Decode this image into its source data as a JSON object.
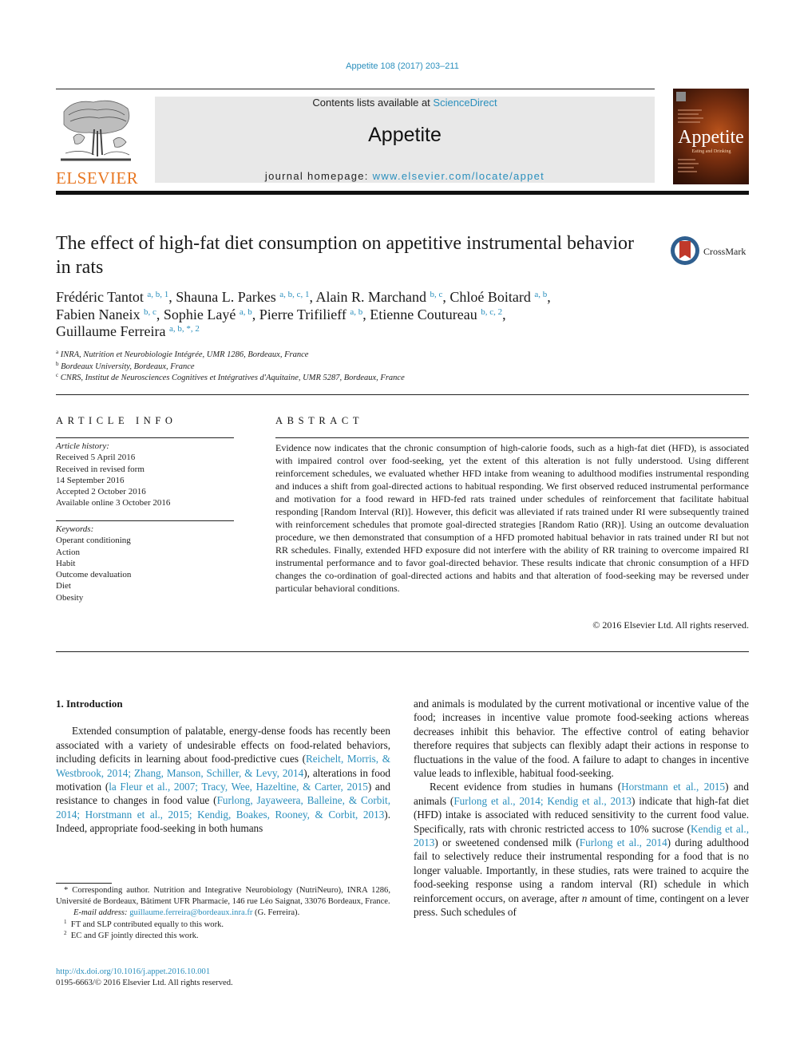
{
  "running_head": "Appetite 108 (2017) 203–211",
  "masthead": {
    "contents_prefix": "Contents lists available at ",
    "contents_link": "ScienceDirect",
    "journal_title": "Appetite",
    "homepage_prefix": "journal homepage: ",
    "homepage_link": "www.elsevier.com/locate/appet"
  },
  "publisher_logo": {
    "wordmark": "ELSEVIER",
    "icon": "elsevier-tree-icon",
    "color": "#e87722"
  },
  "cover": {
    "title": "Appetite",
    "subtitle": "Eating and Drinking"
  },
  "crossmark": {
    "label": "CrossMark",
    "icon": "crossmark-icon"
  },
  "article": {
    "title": "The effect of high-fat diet consumption on appetitive instrumental behavior in rats",
    "authors": [
      {
        "name": "Frédéric Tantot",
        "sup": "a, b, 1",
        "sep": ", "
      },
      {
        "name": "Shauna L. Parkes",
        "sup": "a, b, c, 1",
        "sep": ", "
      },
      {
        "name": "Alain R. Marchand",
        "sup": "b, c",
        "sep": ", "
      },
      {
        "name": "Chloé Boitard",
        "sup": "a, b",
        "sep": ","
      },
      {
        "name": "Fabien Naneix",
        "sup": "b, c",
        "sep": ", "
      },
      {
        "name": "Sophie Layé",
        "sup": "a, b",
        "sep": ", "
      },
      {
        "name": "Pierre Trifilieff",
        "sup": "a, b",
        "sep": ", "
      },
      {
        "name": "Etienne Coutureau",
        "sup": "b, c, 2",
        "sep": ","
      },
      {
        "name": "Guillaume Ferreira",
        "sup": "a, b, *, 2",
        "sep": ""
      }
    ],
    "affiliations": [
      {
        "mark": "a",
        "text": "INRA, Nutrition et Neurobiologie Intégrée, UMR 1286, Bordeaux, France"
      },
      {
        "mark": "b",
        "text": "Bordeaux University, Bordeaux, France"
      },
      {
        "mark": "c",
        "text": "CNRS, Institut de Neurosciences Cognitives et Intégratives d'Aquitaine, UMR 5287, Bordeaux, France"
      }
    ]
  },
  "article_info": {
    "heading": "ARTICLE INFO",
    "history_label": "Article history:",
    "history": [
      "Received 5 April 2016",
      "Received in revised form",
      "14 September 2016",
      "Accepted 2 October 2016",
      "Available online 3 October 2016"
    ],
    "keywords_label": "Keywords:",
    "keywords": [
      "Operant conditioning",
      "Action",
      "Habit",
      "Outcome devaluation",
      "Diet",
      "Obesity"
    ]
  },
  "abstract": {
    "heading": "ABSTRACT",
    "text": "Evidence now indicates that the chronic consumption of high-calorie foods, such as a high-fat diet (HFD), is associated with impaired control over food-seeking, yet the extent of this alteration is not fully understood. Using different reinforcement schedules, we evaluated whether HFD intake from weaning to adulthood modifies instrumental responding and induces a shift from goal-directed actions to habitual responding. We first observed reduced instrumental performance and motivation for a food reward in HFD-fed rats trained under schedules of reinforcement that facilitate habitual responding [Random Interval (RI)]. However, this deficit was alleviated if rats trained under RI were subsequently trained with reinforcement schedules that promote goal-directed strategies [Random Ratio (RR)]. Using an outcome devaluation procedure, we then demonstrated that consumption of a HFD promoted habitual behavior in rats trained under RI but not RR schedules. Finally, extended HFD exposure did not interfere with the ability of RR training to overcome impaired RI instrumental performance and to favor goal-directed behavior. These results indicate that chronic consumption of a HFD changes the co-ordination of goal-directed actions and habits and that alteration of food-seeking may be reversed under particular behavioral conditions.",
    "copyright": "© 2016 Elsevier Ltd. All rights reserved."
  },
  "body": {
    "section_heading": "1.  Introduction",
    "left_paragraph": [
      {
        "t": "Extended consumption of palatable, energy-dense foods has recently been associated with a variety of undesirable effects on food-related behaviors, including deficits in learning about food-predictive cues ("
      },
      {
        "l": "Reichelt, Morris, & Westbrook, 2014; Zhang, Manson, Schiller, & Levy, 2014"
      },
      {
        "t": "), alterations in food motivation ("
      },
      {
        "l": "la Fleur et al., 2007; Tracy, Wee, Hazeltine, & Carter, 2015"
      },
      {
        "t": ") and resistance to changes in food value ("
      },
      {
        "l": "Furlong, Jayaweera, Balleine, & Corbit, 2014; Horstmann et al., 2015; Kendig, Boakes, Rooney, & Corbit, 2013"
      },
      {
        "t": "). Indeed, appropriate food-seeking in both humans"
      }
    ],
    "right_paragraph_1": [
      {
        "t": "and animals is modulated by the current motivational or incentive value of the food; increases in incentive value promote food-seeking actions whereas decreases inhibit this behavior. The effective control of eating behavior therefore requires that subjects can flexibly adapt their actions in response to fluctuations in the value of the food. A failure to adapt to changes in incentive value leads to inflexible, habitual food-seeking."
      }
    ],
    "right_paragraph_2": [
      {
        "t": "Recent evidence from studies in humans ("
      },
      {
        "l": "Horstmann et al., 2015"
      },
      {
        "t": ") and animals ("
      },
      {
        "l": "Furlong et al., 2014; Kendig et al., 2013"
      },
      {
        "t": ") indicate that high-fat diet (HFD) intake is associated with reduced sensitivity to the current food value. Specifically, rats with chronic restricted access to 10% sucrose ("
      },
      {
        "l": "Kendig et al., 2013"
      },
      {
        "t": ") or sweetened condensed milk ("
      },
      {
        "l": "Furlong et al., 2014"
      },
      {
        "t": ") during adulthood fail to selectively reduce their instrumental responding for a food that is no longer valuable. Importantly, in these studies, rats were trained to acquire the food-seeking response using a random interval (RI) schedule in which reinforcement occurs, on average, after "
      },
      {
        "i": "n"
      },
      {
        "t": " amount of time, contingent on a lever press. Such schedules of"
      }
    ]
  },
  "footnotes": {
    "corresponding": "* Corresponding author. Nutrition and Integrative Neurobiology (NutriNeuro), INRA 1286, Université de Bordeaux, Bâtiment UFR Pharmacie, 146 rue Léo Saignat, 33076 Bordeaux, France.",
    "email_label": "E-mail address: ",
    "email": "guillaume.ferreira@bordeaux.inra.fr",
    "email_suffix": " (G. Ferreira).",
    "notes": [
      {
        "mark": "1",
        "text": "FT and SLP contributed equally to this work."
      },
      {
        "mark": "2",
        "text": "EC and GF jointly directed this work."
      }
    ]
  },
  "doi": "http://dx.doi.org/10.1016/j.appet.2016.10.001",
  "issn_copyright": "0195-6663/© 2016 Elsevier Ltd. All rights reserved.",
  "colors": {
    "link": "#2a8fbd",
    "elsevier_orange": "#e87722",
    "masthead_bg": "#e8e8e8"
  }
}
